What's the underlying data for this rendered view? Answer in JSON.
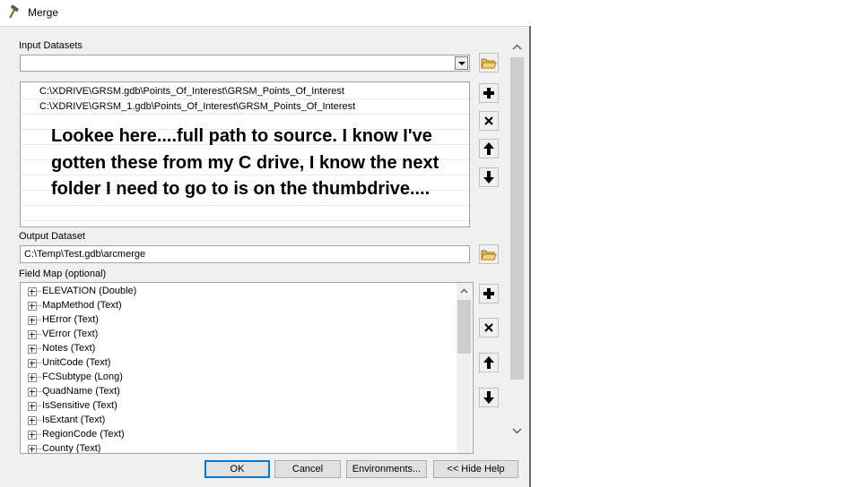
{
  "window": {
    "title": "Merge"
  },
  "input_datasets": {
    "label": "Input Datasets",
    "combo_value": "",
    "items": [
      "C:\\XDRIVE\\GRSM.gdb\\Points_Of_Interest\\GRSM_Points_Of_Interest",
      "C:\\XDRIVE\\GRSM_1.gdb\\Points_Of_Interest\\GRSM_Points_Of_Interest"
    ],
    "annotation": "Lookee here....full path to source. I know I've gotten these from my C drive, I know the next folder I need to go to is on the thumbdrive...."
  },
  "output_dataset": {
    "label": "Output Dataset",
    "value": "C:\\Temp\\Test.gdb\\arcmerge"
  },
  "field_map": {
    "label": "Field Map (optional)",
    "fields": [
      "ELEVATION (Double)",
      "MapMethod (Text)",
      "HError (Text)",
      "VError (Text)",
      "Notes (Text)",
      "UnitCode (Text)",
      "FCSubtype (Long)",
      "QuadName (Text)",
      "IsSensitive (Text)",
      "IsExtant (Text)",
      "RegionCode (Text)",
      "County (Text)"
    ]
  },
  "buttons": {
    "ok": "OK",
    "cancel": "Cancel",
    "environments": "Environments...",
    "hide_help": "<< Hide Help"
  },
  "icons": {
    "title": "hammer-icon",
    "browse": "open-folder-icon",
    "add": "plus-icon",
    "remove": "x-icon",
    "up": "arrow-up-icon",
    "down": "arrow-down-icon"
  }
}
